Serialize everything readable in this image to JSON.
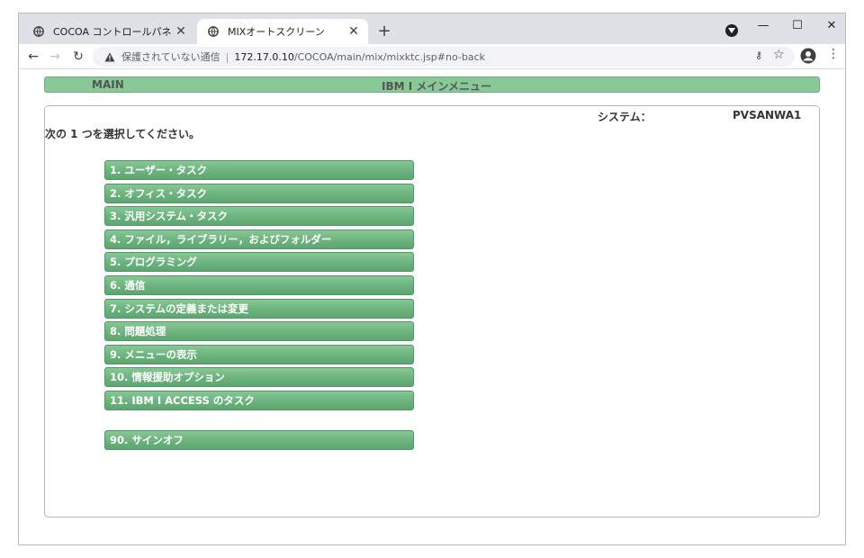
{
  "browser": {
    "tabs": [
      {
        "title": "COCOA コントロールパネル",
        "active": false
      },
      {
        "title": "MIXオートスクリーン",
        "active": true
      }
    ],
    "new_tab_label": "+",
    "insecure_label": "保護されていない通信",
    "separator": "|",
    "url_host": "172.17.0.10",
    "url_path": "/COCOA/main/mix/mixktc.jsp#no-back"
  },
  "icons": {
    "favicon": "globe-icon",
    "warning": "warning-triangle-icon",
    "key": "key-icon",
    "star": "star-icon",
    "account": "account-circle-icon",
    "menu": "kebab-menu-icon"
  },
  "colors": {
    "menu_green": "#6cb37e",
    "header_green": "#88c997"
  },
  "screen": {
    "menu_id": "MAIN",
    "title": "IBM I メインメニュー",
    "system_label": "システム：",
    "system_value": "PVSANWA1",
    "instruction": "次の 1 つを選択してください。",
    "options": [
      {
        "label": "1. ユーザー・タスク"
      },
      {
        "label": "2. オフィス・タスク"
      },
      {
        "label": "3. 汎用システム・タスク"
      },
      {
        "label": "4. ファイル，ライブラリー，およびフォルダー"
      },
      {
        "label": "5. プログラミング"
      },
      {
        "label": "6. 通信"
      },
      {
        "label": "7. システムの定義または変更"
      },
      {
        "label": "8. 問題処理"
      },
      {
        "label": "9. メニューの表示"
      },
      {
        "label": "10. 情報援助オプション"
      },
      {
        "label": "11. IBM I ACCESS のタスク"
      }
    ],
    "signoff": {
      "label": "90. サインオフ"
    }
  }
}
